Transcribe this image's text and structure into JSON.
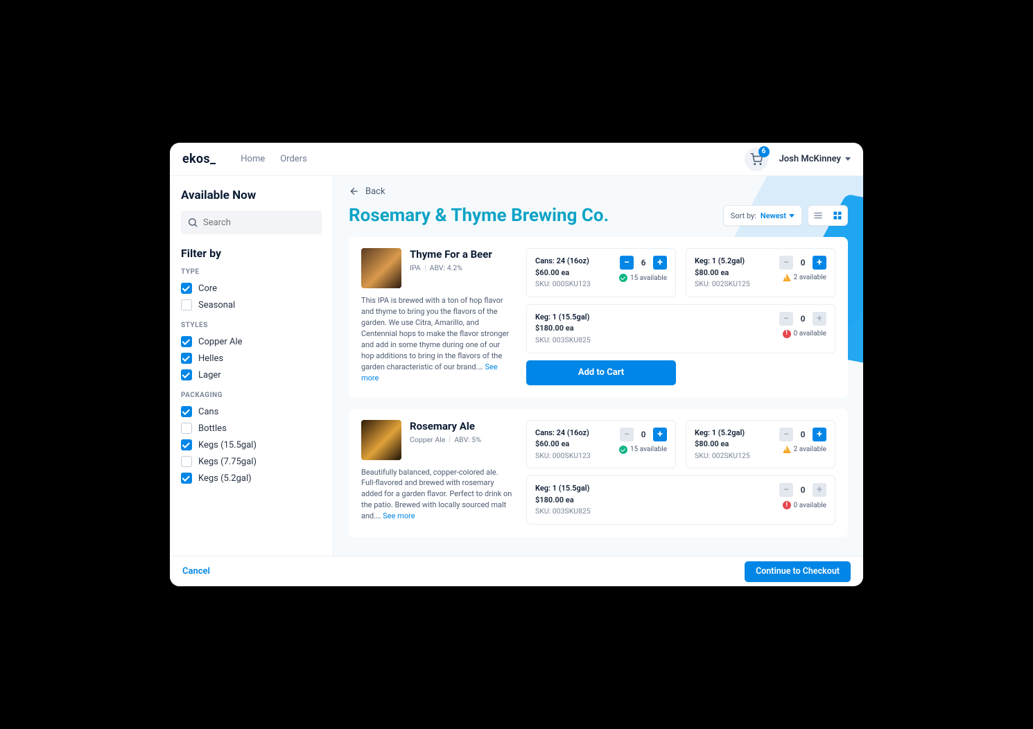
{
  "brand": "ekos_",
  "nav": {
    "home": "Home",
    "orders": "Orders"
  },
  "cart_count": "6",
  "user_name": "Josh McKinney",
  "sidebar": {
    "title": "Available Now",
    "search_placeholder": "Search",
    "filter_title": "Filter by",
    "groups": {
      "type": {
        "label": "TYPE",
        "items": [
          {
            "label": "Core",
            "checked": true
          },
          {
            "label": "Seasonal",
            "checked": false
          }
        ]
      },
      "styles": {
        "label": "STYLES",
        "items": [
          {
            "label": "Copper Ale",
            "checked": true
          },
          {
            "label": "Helles",
            "checked": true
          },
          {
            "label": "Lager",
            "checked": true
          }
        ]
      },
      "packaging": {
        "label": "PACKAGING",
        "items": [
          {
            "label": "Cans",
            "checked": true
          },
          {
            "label": "Bottles",
            "checked": false
          },
          {
            "label": "Kegs (15.5gal)",
            "checked": true
          },
          {
            "label": "Kegs (7.75gal)",
            "checked": false
          },
          {
            "label": "Kegs (5.2gal)",
            "checked": true
          }
        ]
      }
    }
  },
  "back_label": "Back",
  "page_title": "Rosemary & Thyme Brewing Co.",
  "sort": {
    "label": "Sort by:",
    "value": "Newest"
  },
  "products": [
    {
      "name": "Thyme For a Beer",
      "style": "IPA",
      "abv": "ABV: 4.2%",
      "desc": "This IPA is brewed with a ton of hop flavor and thyme to bring you the flavors of the garden. We use Citra, Amarillo, and Centennial hops to make the flavor stronger and add in some thyme during one of our hop additions to bring in the flavors of the garden characteristic of our brand.…",
      "more": "See more",
      "add_label": "Add to Cart",
      "variants": [
        {
          "label": "Cans: 24 (16oz)",
          "price": "$60.00 ea",
          "sku": "SKU: 000SKU123",
          "qty": "6",
          "avail": "15 available",
          "status": "ok",
          "minus_disabled": false
        },
        {
          "label": "Keg: 1 (5.2gal)",
          "price": "$80.00 ea",
          "sku": "SKU: 002SKU125",
          "qty": "0",
          "avail": "2 available",
          "status": "warn",
          "minus_disabled": true
        },
        {
          "label": "Keg: 1 (15.5gal)",
          "price": "$180.00 ea",
          "sku": "SKU: 003SKU825",
          "qty": "0",
          "avail": "0 available",
          "status": "err",
          "minus_disabled": true,
          "plus_disabled": true
        }
      ]
    },
    {
      "name": "Rosemary Ale",
      "style": "Copper Ale",
      "abv": "ABV: 5%",
      "desc": "Beautifully balanced, copper-colored ale. Full-flavored and brewed with rosemary added for a garden flavor. Perfect to drink on the patio. Brewed with locally sourced malt and.…",
      "more": "See more",
      "variants": [
        {
          "label": "Cans: 24 (16oz)",
          "price": "$60.00 ea",
          "sku": "SKU: 000SKU123",
          "qty": "0",
          "avail": "15 available",
          "status": "ok",
          "minus_disabled": true
        },
        {
          "label": "Keg: 1 (5.2gal)",
          "price": "$80.00 ea",
          "sku": "SKU: 002SKU125",
          "qty": "0",
          "avail": "2 available",
          "status": "warn",
          "minus_disabled": true
        },
        {
          "label": "Keg: 1 (15.5gal)",
          "price": "$180.00 ea",
          "sku": "SKU: 003SKU825",
          "qty": "0",
          "avail": "0 available",
          "status": "err",
          "minus_disabled": true,
          "plus_disabled": true
        }
      ]
    }
  ],
  "footer": {
    "cancel": "Cancel",
    "checkout": "Continue to Checkout"
  }
}
